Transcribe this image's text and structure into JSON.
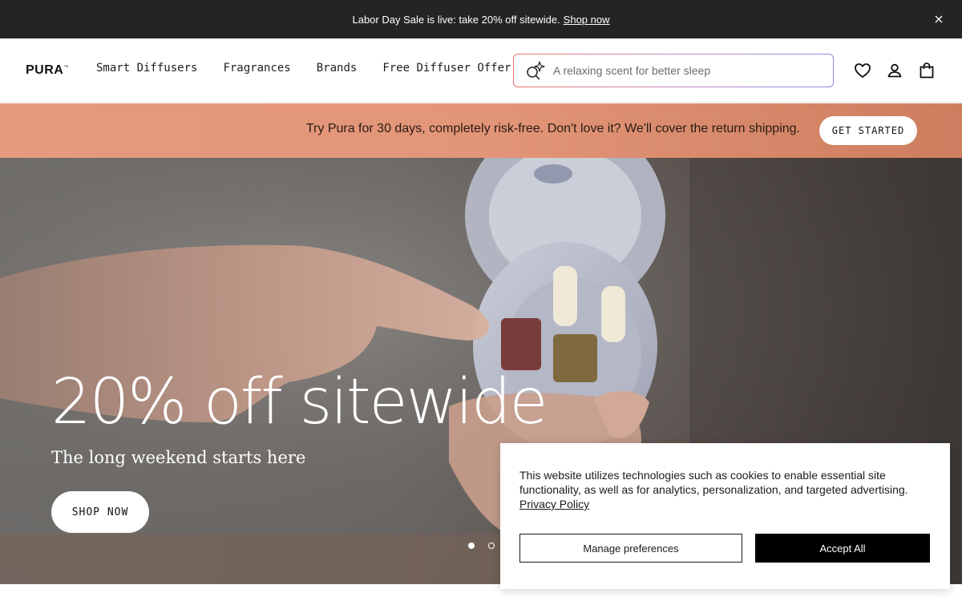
{
  "announcement": {
    "text": "Labor Day Sale is live: take 20% off sitewide.",
    "link": "Shop now"
  },
  "header": {
    "logo": "PURA",
    "logo_mark": "™",
    "nav": [
      "Smart Diffusers",
      "Fragrances",
      "Brands",
      "Free Diffuser Offer"
    ],
    "search_placeholder": "A relaxing scent for better sleep",
    "icons": [
      "heart-icon",
      "account-icon",
      "bag-icon"
    ]
  },
  "promo": {
    "text": "Try Pura for 30 days, completely risk-free. Don't love it? We'll cover the return shipping.",
    "button": "GET STARTED"
  },
  "hero": {
    "headline": "20% off sitewide",
    "subheadline": "The long weekend starts here",
    "button": "SHOP NOW",
    "slides": {
      "count": 2,
      "active": 1
    }
  },
  "cookie_banner": {
    "text": "This website utilizes technologies such as cookies to enable essential site functionality, as well as for analytics, personalization, and targeted advertising.",
    "privacy_link": "Privacy Policy",
    "manage_button": "Manage preferences",
    "accept_button": "Accept All"
  },
  "colors": {
    "announcement_bg": "#242424",
    "promo_bg": "#e39578",
    "accept_bg": "#000000"
  }
}
